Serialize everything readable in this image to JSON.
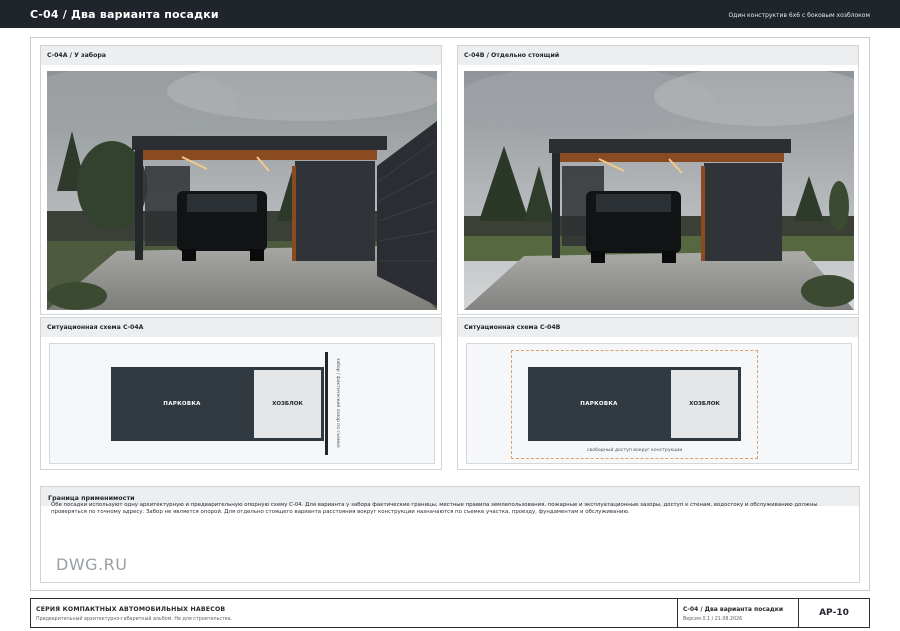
{
  "header": {
    "title": "С-04 / Два варианта посадки",
    "subtitle": "Один конструктив 6х6 с боковым хозблоком"
  },
  "panels": {
    "a": {
      "title": "С-04А / У забора",
      "scheme_title": "Ситуационная схема С-04А"
    },
    "b": {
      "title": "С-04В / Отдельно стоящий",
      "scheme_title": "Ситуационная схема С-04В"
    }
  },
  "scheme": {
    "parking_label": "ПАРКОВКА",
    "shed_label": "ХОЗБЛОК",
    "fence_label": "забор / фактический зазор по съемке",
    "access_label": "свободный доступ вокруг конструкции"
  },
  "notes": {
    "title": "Граница применимости",
    "text": "Обе посадки используют одну архитектурную и предварительную опорную схему С-04. Для варианта у забора фактические границы, местные правила землепользования, пожарные и эксплуатационные зазоры, доступ к стенам, водостоку и обслуживанию должны проверяться по точному адресу. Забор не является опорой. Для отдельно стоящего варианта расстояния вокруг конструкции назначаются по съемке участка, проезду, фундаментам и обслуживанию.",
    "watermark": "DWG.RU"
  },
  "footer": {
    "series": "СЕРИЯ КОМПАКТНЫХ АВТОМОБИЛЬНЫХ НАВЕСОВ",
    "note": "Предварительный архитектурно-габаритный альбом. Не для строительства.",
    "sheet_title": "С-04 / Два варианта посадки",
    "version": "Версия 0.1 / 21.08.2026",
    "code": "АР-10"
  },
  "colors": {
    "header_bg": "#1f252b",
    "parking_fill": "#323a41",
    "shed_fill": "#e4e7ea",
    "access_dash": "#d7a36a",
    "wood_accent": "#8a4a22"
  },
  "icons": [
    "car-image",
    "fence-line"
  ]
}
